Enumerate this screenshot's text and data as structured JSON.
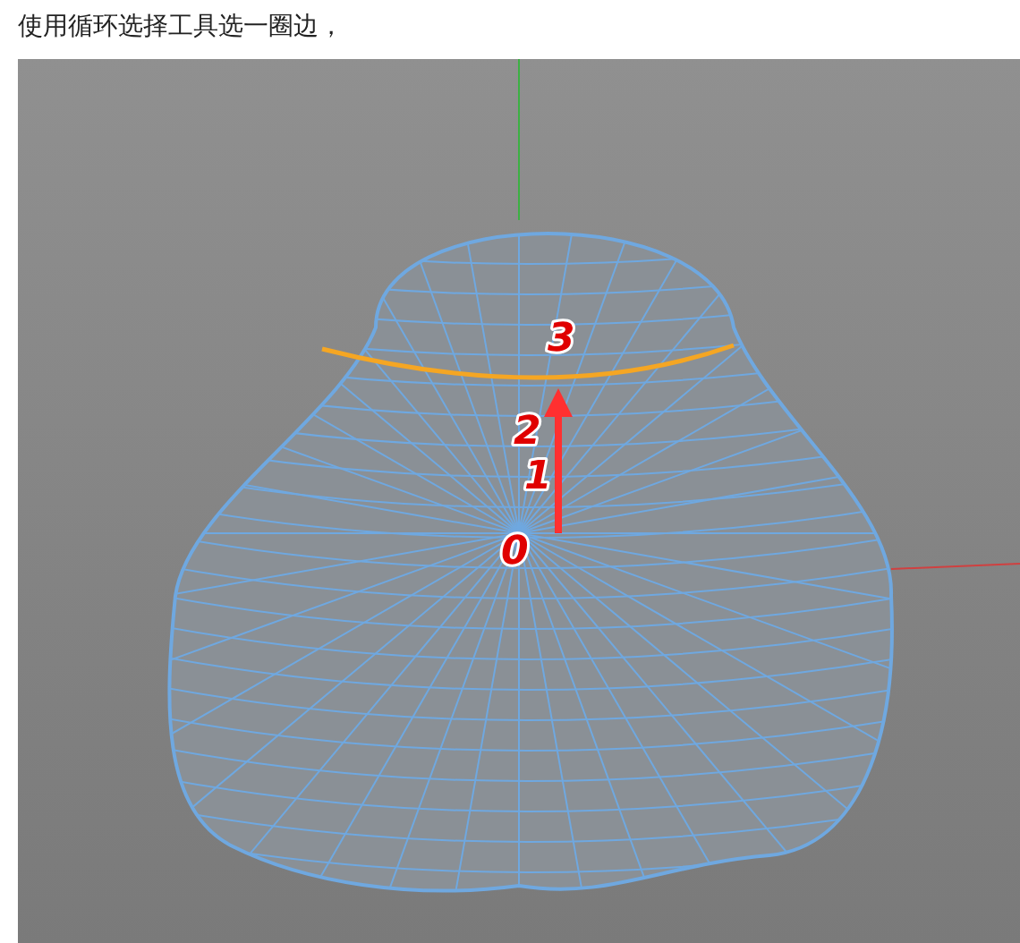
{
  "caption": "使用循环选择工具选一圈边，",
  "viewport": {
    "annotations": [
      {
        "text": "0"
      },
      {
        "text": "1"
      },
      {
        "text": "2"
      },
      {
        "text": "3"
      }
    ]
  }
}
